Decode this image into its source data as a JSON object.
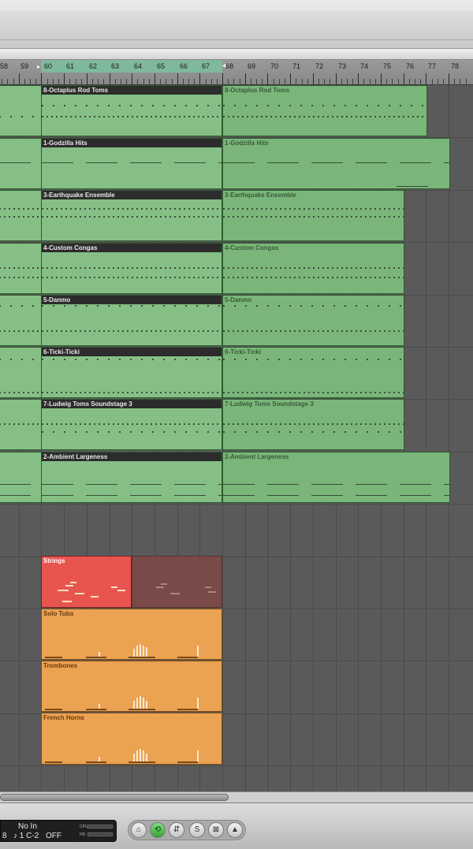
{
  "ruler": {
    "bars": [
      "58",
      "59",
      "60",
      "61",
      "62",
      "63",
      "64",
      "65",
      "66",
      "67",
      "68",
      "69",
      "70",
      "71",
      "72",
      "73",
      "74",
      "75",
      "76",
      "77",
      "78"
    ]
  },
  "regions": [
    {
      "name": "8-Octaplus Rod Toms",
      "ghost_name": "8-Octaplus Rod Toms"
    },
    {
      "name": "1-Godzilla Hits",
      "ghost_name": "1-Godzilla Hits"
    },
    {
      "name": "3-Earthquake Ensemble",
      "ghost_name": "3-Earthquake Ensemble"
    },
    {
      "name": "4-Custom Congas",
      "ghost_name": "4-Custom Congas"
    },
    {
      "name": "5-Danmo",
      "ghost_name": "5-Danmo"
    },
    {
      "name": "6-Ticki-Ticki",
      "ghost_name": "6-Ticki-Ticki"
    },
    {
      "name": "7-Ludwig Toms Soundstage 3",
      "ghost_name": "7-Ludwig Toms Soundstage 3"
    },
    {
      "name": "2-Ambient Largeness",
      "ghost_name": "2-Ambient Largeness"
    }
  ],
  "midi_regions": [
    {
      "name": "Strings",
      "color": "#e8554f"
    },
    {
      "name": "Solo Tuba",
      "color": "#eba251"
    },
    {
      "name": "Trombones",
      "color": "#eba251"
    },
    {
      "name": "French Horns",
      "color": "#eba251"
    }
  ],
  "lcd": {
    "left_edge": "8",
    "midi_in": "No In",
    "midi_out": "♪ 1 C-2",
    "off": "OFF",
    "cpu_label": "CPU",
    "hd_label": "HD"
  },
  "transport_buttons": [
    "settings-icon",
    "cycle-icon",
    "replace-icon",
    "solo-icon",
    "sync-icon",
    "metronome-icon"
  ]
}
